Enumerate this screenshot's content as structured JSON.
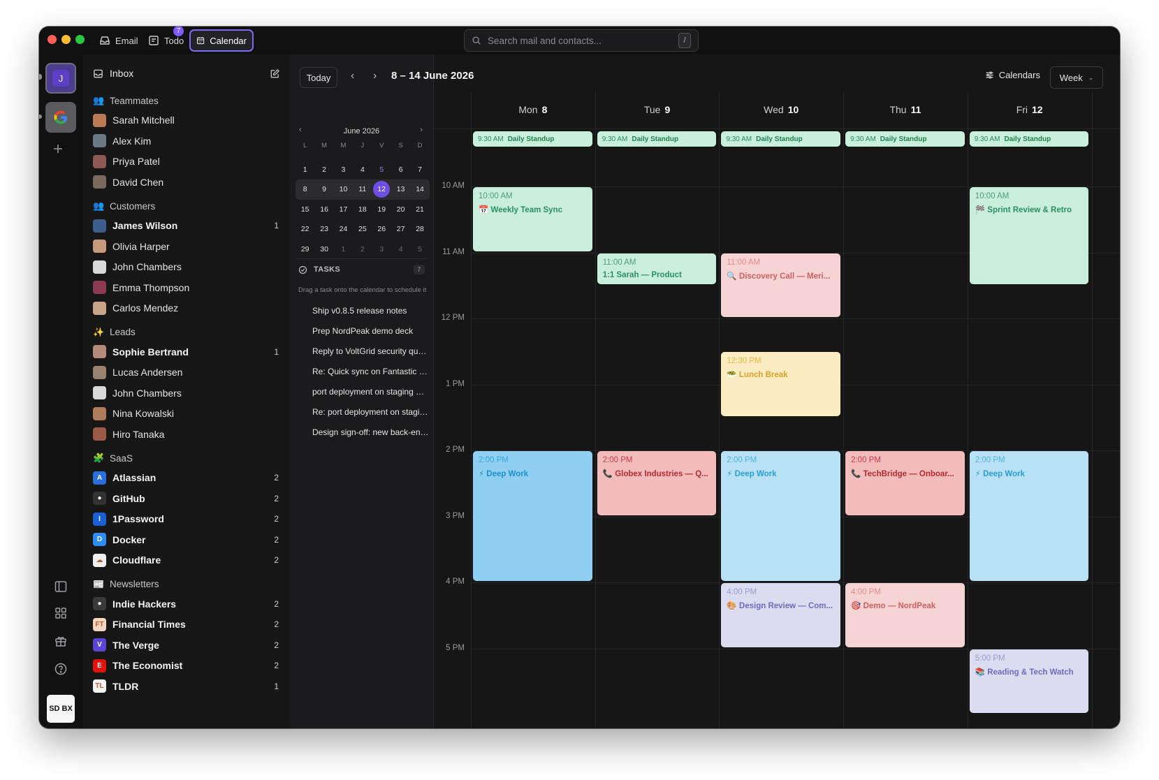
{
  "titlebar": {
    "tabs": [
      {
        "label": "Email",
        "icon": "inbox-tray-icon"
      },
      {
        "label": "Todo",
        "icon": "todo-square-icon",
        "badge": "7"
      },
      {
        "label": "Calendar",
        "icon": "calendar-icon",
        "active": true
      }
    ],
    "search_placeholder": "Search mail and contacts...",
    "search_shortcut": "/"
  },
  "rail": {
    "account_initial": "J",
    "account_google": "G",
    "bottom_badge": "SD BX"
  },
  "sidebar": {
    "inbox_label": "Inbox",
    "sections": [
      {
        "label": "Teammates",
        "icon": "people-icon",
        "items": [
          {
            "name": "Sarah Mitchell",
            "count": "",
            "bold": false,
            "color": "#b97a55"
          },
          {
            "name": "Alex Kim",
            "count": "",
            "bold": false,
            "color": "#6b7a86"
          },
          {
            "name": "Priya Patel",
            "count": "",
            "bold": false,
            "color": "#8c5a52"
          },
          {
            "name": "David Chen",
            "count": "",
            "bold": false,
            "color": "#7a6a5e"
          }
        ]
      },
      {
        "label": "Customers",
        "icon": "customers-icon",
        "items": [
          {
            "name": "James Wilson",
            "count": "1",
            "bold": true,
            "color": "#3b5e8c"
          },
          {
            "name": "Olivia Harper",
            "count": "",
            "bold": false,
            "color": "#c59a7c"
          },
          {
            "name": "John Chambers",
            "count": "",
            "bold": false,
            "color": "#d9d9d9"
          },
          {
            "name": "Emma Thompson",
            "count": "",
            "bold": false,
            "color": "#8c3a52"
          },
          {
            "name": "Carlos Mendez",
            "count": "",
            "bold": false,
            "color": "#c7a48a"
          }
        ]
      },
      {
        "label": "Leads",
        "icon": "sparkles-icon",
        "items": [
          {
            "name": "Sophie Bertrand",
            "count": "1",
            "bold": true,
            "color": "#b58a7a"
          },
          {
            "name": "Lucas Andersen",
            "count": "",
            "bold": false,
            "color": "#9a8270"
          },
          {
            "name": "John Chambers",
            "count": "",
            "bold": false,
            "color": "#d9d9d9"
          },
          {
            "name": "Nina Kowalski",
            "count": "",
            "bold": false,
            "color": "#b07b5a"
          },
          {
            "name": "Hiro Tanaka",
            "count": "",
            "bold": false,
            "color": "#9b5a45"
          }
        ]
      },
      {
        "label": "SaaS",
        "icon": "puzzle-icon",
        "items": [
          {
            "name": "Atlassian",
            "count": "2",
            "bold": true,
            "color": "#2a6fdb",
            "glyph": "A"
          },
          {
            "name": "GitHub",
            "count": "2",
            "bold": true,
            "color": "#333333",
            "glyph": "●"
          },
          {
            "name": "1Password",
            "count": "2",
            "bold": true,
            "color": "#1a5fd6",
            "glyph": "I"
          },
          {
            "name": "Docker",
            "count": "2",
            "bold": true,
            "color": "#2f8cf0",
            "glyph": "D"
          },
          {
            "name": "Cloudflare",
            "count": "2",
            "bold": true,
            "color": "#f0f0f0",
            "glyph": "☁"
          }
        ]
      },
      {
        "label": "Newsletters",
        "icon": "newspaper-icon",
        "items": [
          {
            "name": "Indie Hackers",
            "count": "2",
            "bold": true,
            "color": "#3a3a3a",
            "glyph": "●"
          },
          {
            "name": "Financial Times",
            "count": "2",
            "bold": true,
            "color": "#f3d6c2",
            "glyph": "FT"
          },
          {
            "name": "The Verge",
            "count": "2",
            "bold": true,
            "color": "#5b45d6",
            "glyph": "V"
          },
          {
            "name": "The Economist",
            "count": "2",
            "bold": true,
            "color": "#e3120b",
            "glyph": "E"
          },
          {
            "name": "TLDR",
            "count": "1",
            "bold": true,
            "color": "#f2f2f2",
            "glyph": "TL"
          }
        ]
      }
    ]
  },
  "toolbar": {
    "today_label": "Today",
    "range_title": "8 – 14 June 2026",
    "calendars_label": "Calendars",
    "view_label": "Week"
  },
  "minical": {
    "month_label": "June 2026",
    "dow": [
      "L",
      "M",
      "M",
      "J",
      "V",
      "S",
      "D"
    ],
    "weeks": [
      [
        "1",
        "2",
        "3",
        "4",
        "5",
        "6",
        "7"
      ],
      [
        "8",
        "9",
        "10",
        "11",
        "12",
        "13",
        "14"
      ],
      [
        "15",
        "16",
        "17",
        "18",
        "19",
        "20",
        "21"
      ],
      [
        "22",
        "23",
        "24",
        "25",
        "26",
        "27",
        "28"
      ],
      [
        "29",
        "30",
        "1",
        "2",
        "3",
        "4",
        "5"
      ]
    ],
    "today": "12"
  },
  "tasks": {
    "header": "TASKS",
    "count": "7",
    "hint": "Drag a task onto the calendar to schedule it",
    "items": [
      "Ship v0.8.5 release notes",
      "Prep NordPeak demo deck",
      "Reply to VoltGrid security que...",
      "Re: Quick sync on Fantastic Gr...",
      "port deployment on staging — f...",
      "Re: port deployment on stagin...",
      "Design sign-off: new back-end ..."
    ]
  },
  "week": {
    "days": [
      {
        "dow": "Mon",
        "num": "8"
      },
      {
        "dow": "Tue",
        "num": "9"
      },
      {
        "dow": "Wed",
        "num": "10"
      },
      {
        "dow": "Thu",
        "num": "11"
      },
      {
        "dow": "Fri",
        "num": "12"
      }
    ],
    "hours": [
      "10 AM",
      "11 AM",
      "12 PM",
      "1 PM",
      "2 PM",
      "3 PM",
      "4 PM",
      "5 PM"
    ],
    "standup": {
      "time": "9:30 AM",
      "title": "Daily Standup"
    },
    "events": [
      {
        "day": 0,
        "start": 10.0,
        "end": 11.0,
        "time": "10:00 AM",
        "title": "📅 Weekly Team Sync",
        "style": "green"
      },
      {
        "day": 0,
        "start": 14.0,
        "end": 16.0,
        "time": "2:00 PM",
        "title": "⚡ Deep Work",
        "style": "blue-strong"
      },
      {
        "day": 1,
        "start": 11.0,
        "end": 11.5,
        "time": "11:00 AM",
        "title": "1:1 Sarah — Product",
        "style": "green"
      },
      {
        "day": 1,
        "start": 14.0,
        "end": 15.0,
        "time": "2:00 PM",
        "title": "📞 Globex Industries — Q...",
        "style": "red"
      },
      {
        "day": 2,
        "start": 11.0,
        "end": 12.0,
        "time": "11:00 AM",
        "title": "🔍 Discovery Call — Meri...",
        "style": "pink"
      },
      {
        "day": 2,
        "start": 12.5,
        "end": 13.5,
        "time": "12:30 PM",
        "title": "🥗 Lunch Break",
        "style": "yellow"
      },
      {
        "day": 2,
        "start": 14.0,
        "end": 16.0,
        "time": "2:00 PM",
        "title": "⚡ Deep Work",
        "style": "blue"
      },
      {
        "day": 2,
        "start": 16.0,
        "end": 17.0,
        "time": "4:00 PM",
        "title": "🎨 Design Review — Com...",
        "style": "lav"
      },
      {
        "day": 3,
        "start": 14.0,
        "end": 15.0,
        "time": "2:00 PM",
        "title": "📞 TechBridge — Onboar...",
        "style": "red"
      },
      {
        "day": 3,
        "start": 16.0,
        "end": 17.0,
        "time": "4:00 PM",
        "title": "🎯 Demo — NordPeak",
        "style": "pink"
      },
      {
        "day": 4,
        "start": 10.0,
        "end": 11.5,
        "time": "10:00 AM",
        "title": "🏁 Sprint Review & Retro",
        "style": "green"
      },
      {
        "day": 4,
        "start": 14.0,
        "end": 16.0,
        "time": "2:00 PM",
        "title": "⚡ Deep Work",
        "style": "blue"
      },
      {
        "day": 4,
        "start": 17.0,
        "end": 18.0,
        "time": "5:00 PM",
        "title": "📚 Reading & Tech Watch",
        "style": "lav"
      }
    ]
  }
}
